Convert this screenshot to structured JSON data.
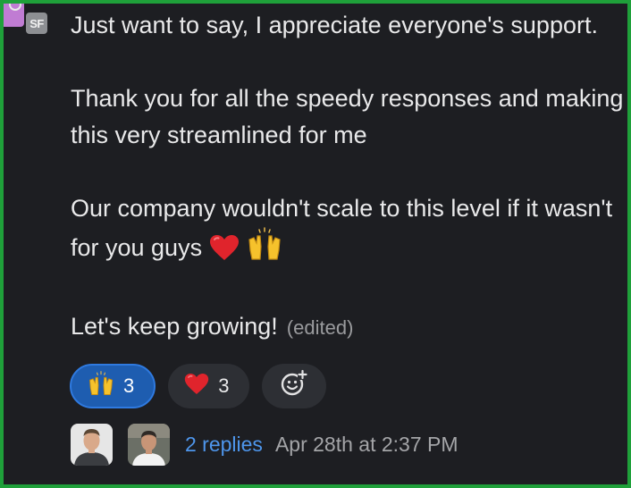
{
  "avatar": {
    "initials": "SF",
    "icon": "workspace-avatar"
  },
  "message": {
    "line1": "Just want to say, I appreciate everyone's support.",
    "paragraph2": "Thank you for all the speedy responses and making this very streamlined for me",
    "paragraph3": "Our company wouldn't scale to this level if it wasn't for you guys",
    "paragraph4": "Let's keep growing!",
    "edited_label": "(edited)",
    "inline_emojis": [
      "red-heart",
      "raising-hands"
    ]
  },
  "reactions": [
    {
      "emoji": "raising-hands",
      "count": "3",
      "active": true
    },
    {
      "emoji": "red-heart",
      "count": "3",
      "active": false
    },
    {
      "emoji": "add-reaction",
      "count": "",
      "active": false
    }
  ],
  "thread": {
    "avatars": [
      "user-avatar-1",
      "user-avatar-2"
    ],
    "replies_label": "2 replies",
    "timestamp": "Apr 28th at 2:37 PM"
  },
  "colors": {
    "background": "#1d1e22",
    "border": "#1fa03a",
    "link": "#4e96ec",
    "active_reaction": "#1e5db0"
  }
}
